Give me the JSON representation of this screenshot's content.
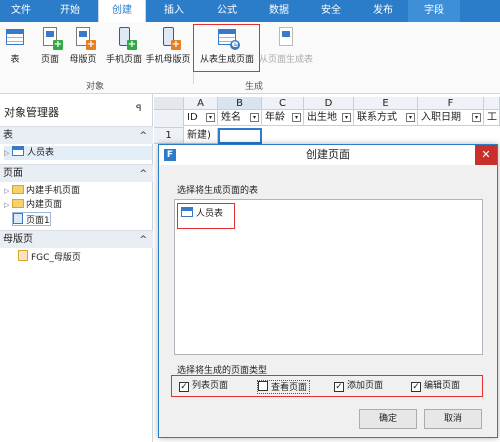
{
  "ribbon": {
    "tabs": [
      "文件",
      "开始",
      "创建",
      "插入",
      "公式",
      "数据",
      "安全",
      "发布",
      "字段"
    ],
    "active_tab": "创建",
    "object_group": {
      "label": "对象",
      "buttons": [
        "表",
        "页面",
        "母版页",
        "手机页面",
        "手机母版页"
      ]
    },
    "generate_group": {
      "label": "生成",
      "buttons": [
        "从表生成页面",
        "从页面生成表"
      ]
    }
  },
  "object_manager": {
    "title": "对象管理器",
    "pin": "ꟼ",
    "sections": [
      {
        "title": "表",
        "items": [
          "人员表"
        ]
      },
      {
        "title": "页面",
        "items": [
          "内建手机页面",
          "内建页面",
          "页面1"
        ]
      },
      {
        "title": "母版页",
        "items": [
          "FGC_母版页"
        ]
      }
    ]
  },
  "sheet": {
    "columns": [
      "A",
      "B",
      "C",
      "D",
      "E",
      "F"
    ],
    "headers": [
      "ID",
      "姓名",
      "年龄",
      "出生地",
      "联系方式",
      "入职日期",
      "工"
    ],
    "row_number": "1",
    "row_values": [
      "新建)",
      "",
      "",
      "",
      "",
      ""
    ]
  },
  "dialog": {
    "title": "创建页面",
    "logo": "F",
    "close": "✕",
    "table_label": "选择将生成页面的表",
    "tables": [
      "人员表"
    ],
    "type_label": "选择将生成的页面类型",
    "page_types": [
      {
        "label": "列表页面",
        "checked": true
      },
      {
        "label": "查看页面",
        "checked": false
      },
      {
        "label": "添加页面",
        "checked": true
      },
      {
        "label": "编辑页面",
        "checked": true
      }
    ],
    "ok_button": "确定",
    "cancel_button": "取消"
  },
  "colors": {
    "accent": "#2b7cc9",
    "highlight": "#e03030",
    "close": "#c9302c"
  }
}
